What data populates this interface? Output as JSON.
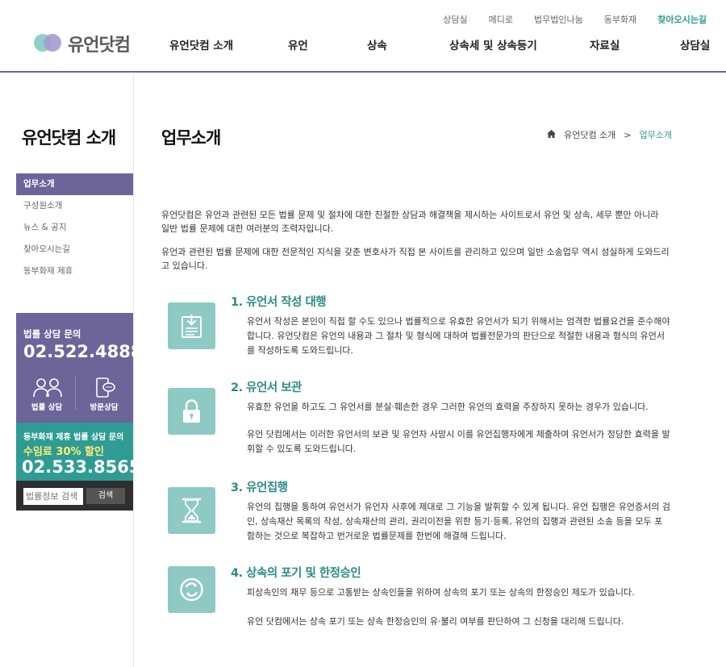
{
  "header": {
    "util": [
      "상담실",
      "메디로",
      "법무법인나눔",
      "동부화재",
      "찾아오시는길"
    ],
    "logo": "유언닷컴",
    "nav": [
      "유언닷컴 소개",
      "유언",
      "상속",
      "상속세 및 상속등기",
      "자료실",
      "상담실"
    ]
  },
  "sidebar": {
    "title": "유언닷컴 소개",
    "items": [
      "업무소개",
      "구성원소개",
      "뉴스 & 공지",
      "찾아오시는길",
      "동부화재 제휴"
    ],
    "consult": {
      "title": "법률 상담 문의",
      "phone": "02.522.4888",
      "btn1": "법률 상담",
      "btn2": "방문상담"
    },
    "promo": {
      "line1": "동부화재 제휴 법률 상담 문의",
      "line2": "수임료 30% 할인",
      "phone": "02.533.8565"
    },
    "search": {
      "placeholder": "법률정보 검색",
      "button": "검색"
    }
  },
  "main": {
    "title": "업무소개",
    "breadcrumb": [
      "유언닷컴 소개",
      ">",
      "업무소개"
    ],
    "intro": [
      "유언닷컴은 유언과 관련된 모든 법률 문제 및 절차에 대한 친절한 상담과 해결책을 제시하는 사이트로서 유언 및 상속, 세무 뿐만 아니라 일반 법률 문제에 대한 여러분의 조력자입니다.",
      "유언과 관련된 법률 문제에 대한 전문적인 지식을 갖춘 변호사가 직접 본 사이트를 관리하고 있으며 일반 소송업무 역시 성실하게 도와드리고 있습니다."
    ],
    "items": [
      {
        "title": "1. 유언서 작성 대행",
        "body": "유언서 작성은 본인이 직접 할 수도 있으나 법률적으로 유효한 유언서가 되기 위해서는 엄격한 법률요건을 준수해야 합니다. 유언닷컴은 유언의 내용과 그 절차 및 형식에 대하여 법률전문가의 판단으로 적절한 내용과 형식의 유언서를 작성하도록 도와드립니다.",
        "icon": "document-download-icon"
      },
      {
        "title": "2. 유언서 보관",
        "body": "유효한 유언을 하고도 그 유언서를 분실·훼손한 경우 그러한 유언의 효력을 주장하지 못하는 경우가 있습니다.",
        "body2": "유언 닷컴에서는 이러한 유언서의 보관 및 유언자 사망시 이를 유언집행자에게 제출하여 유언서가 정당한 효력을 발휘할 수 있도록 도와드립니다.",
        "icon": "lock-icon"
      },
      {
        "title": "3. 유언집행",
        "body": "유언의 집행을 통하여 유언서가 유언자 사후에 제대로 그 기능을 발휘할 수 있게 됩니다. 유언 집행은 유언증서의 검인, 상속재산 목록의 작성, 상속재산의 관리, 권리이전을 위한 등기·등록, 유언의 집행과 관련된 소송 등을 모두 포함하는 것으로 복잡하고 번거로운 법률문제를 한번에 해결해 드립니다.",
        "icon": "hourglass-icon"
      },
      {
        "title": "4. 상속의 포기 및 한정승인",
        "body": "피상속인의 채무 등으로 고통받는 상속인들을 위하여 상속의 포기 또는 상속의 한정승인 제도가 있습니다.",
        "body2": "유언 닷컴에서는 상속 포기 또는 상속 한정승인의 유·불리 여부를 판단하여 그 신청을 대리해 드립니다.",
        "icon": "cycle-icon"
      }
    ]
  },
  "colors": {
    "primary": "#6d6599",
    "teal": "#2f9c94",
    "icon_bg": "#8ec9c4",
    "title_teal": "#2c8a86"
  }
}
